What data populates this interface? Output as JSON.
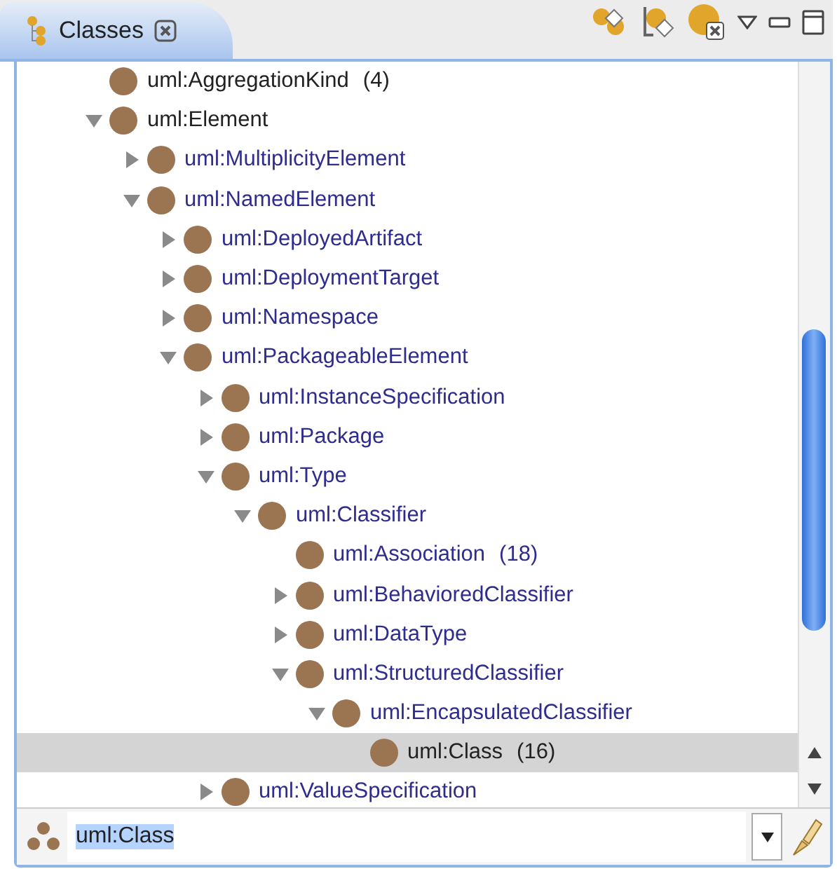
{
  "tab": {
    "title": "Classes",
    "selected": true
  },
  "tree": [
    {
      "label": "uml:AggregationKind",
      "count": "(4)",
      "kind": "leaf",
      "selected": false,
      "color": "#222222"
    },
    {
      "label": "uml:Element",
      "kind": "branch",
      "expanded": true,
      "selected": false,
      "color": "#222222",
      "children": [
        {
          "label": "uml:MultiplicityElement",
          "kind": "branch",
          "expanded": false,
          "selected": false,
          "color": "#2e2c8c"
        },
        {
          "label": "uml:NamedElement",
          "kind": "branch",
          "expanded": true,
          "selected": false,
          "color": "#2e2c8c",
          "children": [
            {
              "label": "uml:DeployedArtifact",
              "kind": "branch",
              "expanded": false,
              "selected": false,
              "color": "#2e2c8c"
            },
            {
              "label": "uml:DeploymentTarget",
              "kind": "branch",
              "expanded": false,
              "selected": false,
              "color": "#2e2c8c"
            },
            {
              "label": "uml:Namespace",
              "kind": "branch",
              "expanded": false,
              "selected": false,
              "color": "#2e2c8c"
            },
            {
              "label": "uml:PackageableElement",
              "kind": "branch",
              "expanded": true,
              "selected": false,
              "color": "#2e2c8c",
              "children": [
                {
                  "label": "uml:InstanceSpecification",
                  "kind": "branch",
                  "expanded": false,
                  "selected": false,
                  "color": "#2e2c8c"
                },
                {
                  "label": "uml:Package",
                  "kind": "branch",
                  "expanded": false,
                  "selected": false,
                  "color": "#2e2c8c"
                },
                {
                  "label": "uml:Type",
                  "kind": "branch",
                  "expanded": true,
                  "selected": false,
                  "color": "#2e2c8c",
                  "children": [
                    {
                      "label": "uml:Classifier",
                      "kind": "branch",
                      "expanded": true,
                      "selected": false,
                      "color": "#2e2c8c",
                      "children": [
                        {
                          "label": "uml:Association",
                          "count": "(18)",
                          "kind": "leaf",
                          "selected": false,
                          "color": "#2e2c8c"
                        },
                        {
                          "label": "uml:BehavioredClassifier",
                          "kind": "branch",
                          "expanded": false,
                          "selected": false,
                          "color": "#2e2c8c"
                        },
                        {
                          "label": "uml:DataType",
                          "kind": "branch",
                          "expanded": false,
                          "selected": false,
                          "color": "#2e2c8c"
                        },
                        {
                          "label": "uml:StructuredClassifier",
                          "kind": "branch",
                          "expanded": true,
                          "selected": false,
                          "color": "#2e2c8c",
                          "children": [
                            {
                              "label": "uml:EncapsulatedClassifier",
                              "kind": "branch",
                              "expanded": true,
                              "selected": false,
                              "color": "#2e2c8c",
                              "children": [
                                {
                                  "label": "uml:Class",
                                  "count": "(16)",
                                  "kind": "leaf",
                                  "selected": true,
                                  "color": "#222222"
                                }
                              ]
                            }
                          ]
                        }
                      ]
                    }
                  ]
                },
                {
                  "label": "uml:ValueSpecification",
                  "kind": "branch",
                  "expanded": false,
                  "selected": false,
                  "color": "#2e2c8c"
                }
              ]
            }
          ]
        }
      ]
    }
  ],
  "search": {
    "value": "uml:Class"
  }
}
